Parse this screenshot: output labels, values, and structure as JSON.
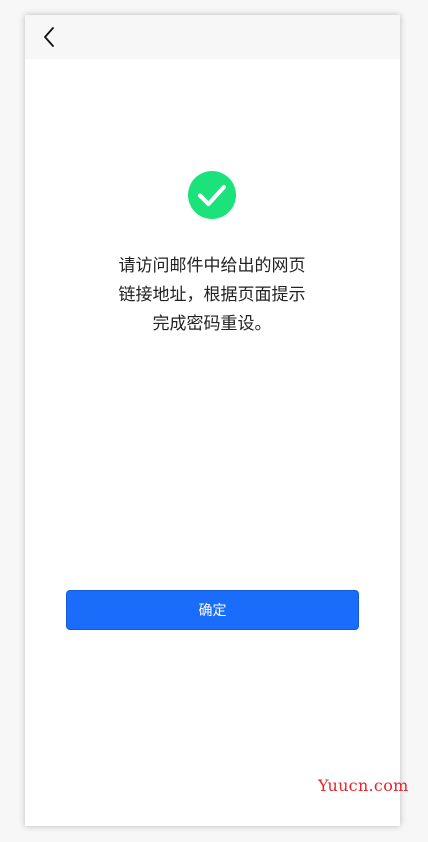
{
  "message": {
    "lines": [
      "请访问邮件中给出的网页",
      "链接地址，根据页面提示",
      "完成密码重设。"
    ]
  },
  "actions": {
    "confirm_label": "确定"
  },
  "watermark": {
    "text": "Yuucn.com"
  },
  "colors": {
    "primary": "#1a6dfb",
    "success": "#1be27a",
    "watermark": "#e8232a"
  },
  "icons": {
    "back": "chevron-left-icon",
    "success": "checkmark-circle-icon"
  }
}
